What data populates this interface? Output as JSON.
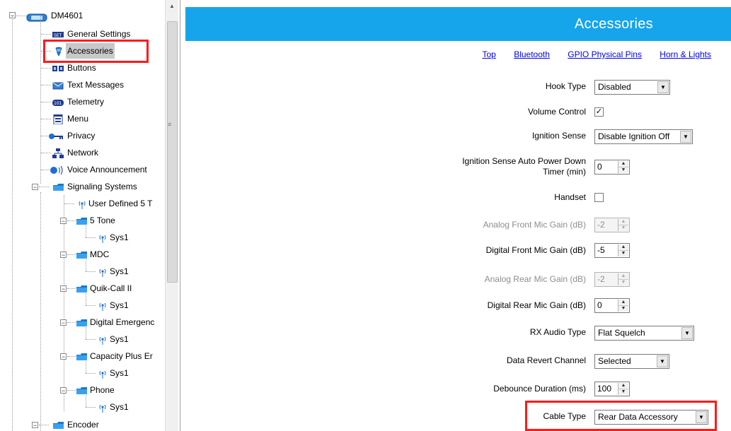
{
  "tree": {
    "root": "DM4601",
    "items": [
      {
        "label": "General Settings",
        "icon": "general-settings-icon"
      },
      {
        "label": "Accessories",
        "icon": "accessories-icon",
        "selected": true
      },
      {
        "label": "Buttons",
        "icon": "buttons-icon"
      },
      {
        "label": "Text Messages",
        "icon": "envelope-icon"
      },
      {
        "label": "Telemetry",
        "icon": "telemetry-icon"
      },
      {
        "label": "Menu",
        "icon": "menu-icon"
      },
      {
        "label": "Privacy",
        "icon": "key-icon"
      },
      {
        "label": "Network",
        "icon": "network-icon"
      },
      {
        "label": "Voice Announcement",
        "icon": "voice-announcement-icon"
      },
      {
        "label": "Signaling Systems",
        "icon": "folder-icon"
      },
      {
        "label": "User Defined 5 T",
        "icon": "antenna-icon"
      },
      {
        "label": "5 Tone",
        "icon": "folder-icon"
      },
      {
        "label": "Sys1",
        "icon": "antenna-icon"
      },
      {
        "label": "MDC",
        "icon": "folder-icon"
      },
      {
        "label": "Sys1",
        "icon": "antenna-icon"
      },
      {
        "label": "Quik-Call II",
        "icon": "folder-icon"
      },
      {
        "label": "Sys1",
        "icon": "antenna-icon"
      },
      {
        "label": "Digital Emergenc",
        "icon": "folder-icon"
      },
      {
        "label": "Sys1",
        "icon": "antenna-icon"
      },
      {
        "label": "Capacity Plus Er",
        "icon": "folder-icon"
      },
      {
        "label": "Sys1",
        "icon": "antenna-icon"
      },
      {
        "label": "Phone",
        "icon": "folder-icon"
      },
      {
        "label": "Sys1",
        "icon": "antenna-icon"
      },
      {
        "label": "Encoder",
        "icon": "folder-icon"
      }
    ]
  },
  "header": {
    "title": "Accessories"
  },
  "links": [
    "Top",
    "Bluetooth",
    "GPIO Physical Pins",
    "Horn & Lights"
  ],
  "fields": {
    "hook_type": {
      "label": "Hook Type",
      "value": "Disabled"
    },
    "volume_control": {
      "label": "Volume Control",
      "checked": true,
      "mark": "✓"
    },
    "ignition_sense": {
      "label": "Ignition Sense",
      "value": "Disable Ignition Off"
    },
    "ignition_timer": {
      "label_line1": "Ignition Sense Auto Power Down",
      "label_line2": "Timer (min)",
      "value": "0"
    },
    "handset": {
      "label": "Handset",
      "checked": false
    },
    "analog_front_mic": {
      "label": "Analog Front Mic Gain (dB)",
      "value": "-2",
      "disabled": true
    },
    "digital_front_mic": {
      "label": "Digital Front Mic Gain (dB)",
      "value": "-5"
    },
    "analog_rear_mic": {
      "label": "Analog Rear Mic Gain (dB)",
      "value": "-2",
      "disabled": true
    },
    "digital_rear_mic": {
      "label": "Digital Rear Mic Gain (dB)",
      "value": "0"
    },
    "rx_audio_type": {
      "label": "RX Audio Type",
      "value": "Flat Squelch"
    },
    "data_revert_channel": {
      "label": "Data Revert Channel",
      "value": "Selected"
    },
    "debounce_duration": {
      "label": "Debounce Duration (ms)",
      "value": "100"
    },
    "cable_type": {
      "label": "Cable Type",
      "value": "Rear Data Accessory"
    }
  },
  "colors": {
    "header_bg": "#16a5ea",
    "highlight_box": "#ff1a1a",
    "link": "#0000ee"
  }
}
